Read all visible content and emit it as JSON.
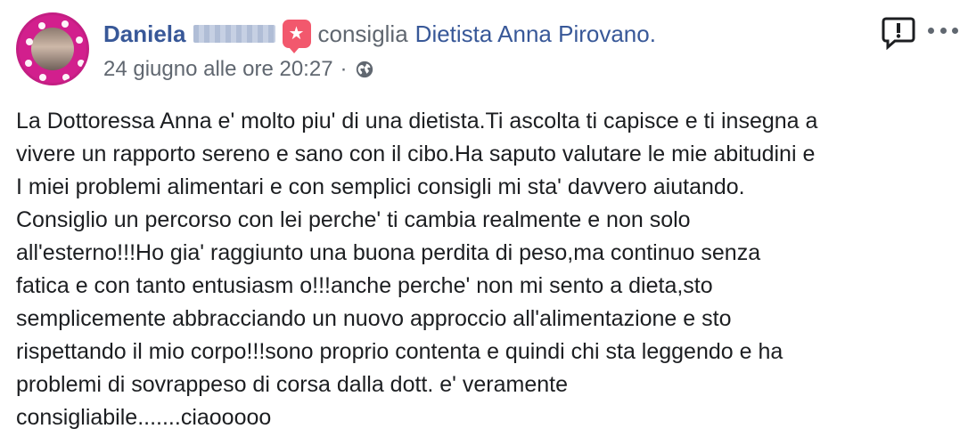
{
  "post": {
    "author_first_name": "Daniela",
    "action_text": "consiglia",
    "page_name": "Dietista Anna Pirovano.",
    "timestamp": "24 giugno alle ore 20:27",
    "separator": "·",
    "content": "La Dottoressa Anna e' molto piu' di una dietista.Ti ascolta ti capisce e ti insegna a\nvivere un rapporto sereno e sano con il cibo.Ha saputo valutare le mie abitudini e\nI miei problemi alimentari e con semplici consigli mi sta' davvero aiutando.\nConsiglio un percorso con lei perche' ti cambia realmente e non solo\nall'esterno!!!Ho gia' raggiunto una buona perdita di peso,ma continuo senza\nfatica e con tanto entusiasm o!!!anche perche' non mi sento a dieta,sto\nsemplicemente abbracciando un nuovo approccio all'alimentazione e sto\nrispettando il mio corpo!!!sono proprio contenta e quindi chi sta leggendo e ha\nproblemi di sovrappeso di corsa dalla dott. e' veramente\nconsigliabile.......ciaooooo"
  },
  "icons": {
    "recommend_badge": "recommend-star-icon",
    "globe": "globe-icon",
    "report": "report-icon",
    "more": "more-options-icon"
  },
  "colors": {
    "link_blue": "#385898",
    "meta_gray": "#606770",
    "recommend_red": "#f2586d",
    "avatar_border": "#c41e83"
  }
}
